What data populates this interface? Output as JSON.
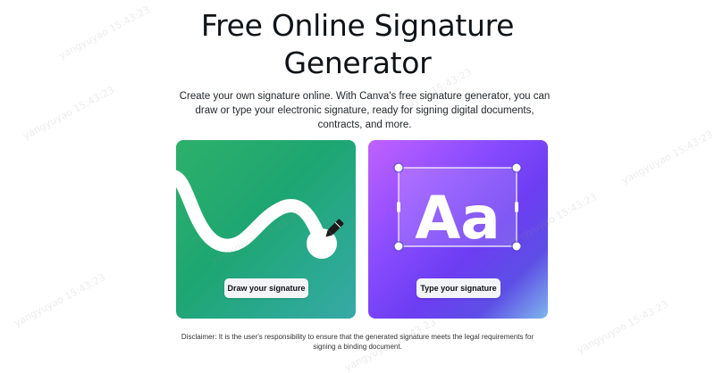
{
  "header": {
    "title_line1": "Free Online Signature",
    "title_line2": "Generator",
    "subtitle": "Create your own signature online. With Canva's free signature generator, you can draw or type your electronic signature, ready for signing digital documents, contracts, and more."
  },
  "cards": {
    "draw": {
      "button_label": "Draw your signature",
      "icon": "pen-icon",
      "color": "#1ea672"
    },
    "type": {
      "art_text": "Aa",
      "button_label": "Type your signature",
      "icon": "text-box-icon",
      "color": "#7a45f5"
    }
  },
  "footer": {
    "disclaimer": "Disclaimer: It is the user's responsibility to ensure that the generated signature meets the legal requirements for signing a binding document."
  },
  "watermark": {
    "text": "yangyuyao 15:43:23"
  }
}
